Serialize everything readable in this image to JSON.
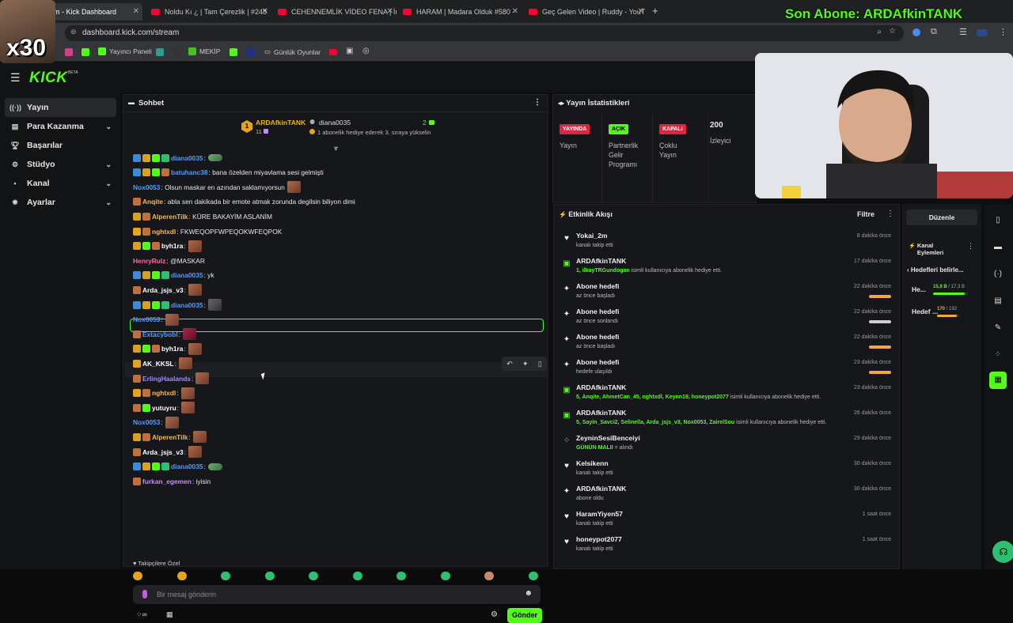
{
  "browser": {
    "tabs": [
      {
        "label": "m - Kick Dashboard",
        "active": true
      },
      {
        "label": "Noldu Kı ¿ | Tam Çerezlik | #248"
      },
      {
        "label": "CEHENNEMLİK VİDEO FENA | İn"
      },
      {
        "label": "HARAM | Madara Olduk #580 -"
      },
      {
        "label": "Geç Gelen Video | Ruddy - YouT"
      }
    ],
    "url": "dashboard.kick.com/stream",
    "bookmarks": [
      "Yayıncı Paneli",
      "MEKİP",
      "Günlük Oyunlar"
    ]
  },
  "overlay": {
    "latest_sub": "Son Abone: ARDAfkinTANK",
    "multiplier": "x30"
  },
  "brand": {
    "logo": "KICK",
    "beta": "BETA",
    "accent": "#53fc18"
  },
  "sidebar": {
    "items": [
      {
        "label": "Yayın",
        "icon": "broadcast-icon",
        "active": true
      },
      {
        "label": "Para Kazanma",
        "icon": "money-icon",
        "chevron": true
      },
      {
        "label": "Başarılar",
        "icon": "trophy-icon"
      },
      {
        "label": "Stüdyo",
        "icon": "studio-icon",
        "chevron": true
      },
      {
        "label": "Kanal",
        "icon": "channel-icon",
        "chevron": true
      },
      {
        "label": "Ayarlar",
        "icon": "settings-icon",
        "chevron": true
      }
    ]
  },
  "chat": {
    "title": "Sohbet",
    "pinned": {
      "rank": "1",
      "user": "ARDAfkinTANK",
      "count": "11",
      "gifter": "diana0035",
      "gift_count": "2",
      "notice": "1 abonelik hediye ederek 3. sıraya yükselin"
    },
    "messages": [
      {
        "user": "diana0035",
        "text": ":",
        "color": "#4f9dff",
        "badges": [
          "#3a8bd8",
          "#d6a21f",
          "#53fc18",
          "#2fbf71"
        ],
        "emote": "g"
      },
      {
        "user": "batuhanc38",
        "text": ": bana özelden miyavlama sesi gelmişti",
        "color": "#4f9dff",
        "badges": [
          "#3a8bd8",
          "#d6a21f",
          "#53fc18",
          "#c0703a"
        ]
      },
      {
        "user": "Nox0053",
        "text": ": Olsun maskar en azından saklamıyorsun",
        "color": "#4f9dff",
        "badges": [],
        "emote": "f"
      },
      {
        "user": "Anqite",
        "text": ": abla sen dakikada bir emote atmak zorunda degilsin biliyon dimi",
        "color": "#ffb74d",
        "badges": [
          "#c0703a"
        ]
      },
      {
        "user": "AlperenTilk",
        "text": ": KÜRE BAKAYİM ASLANİM",
        "color": "#ffb74d",
        "badges": [
          "#d6a21f",
          "#c0703a"
        ]
      },
      {
        "user": "nghtxdl",
        "text": ": FKWEQOPFWPEQOKWFEQPOK",
        "color": "#ffb74d",
        "badges": [
          "#e5a419",
          "#c0703a"
        ]
      },
      {
        "user": "byh1ra",
        "text": ":",
        "color": "#ffffff",
        "badges": [
          "#d6a21f",
          "#53fc18",
          "#c0703a"
        ],
        "emote": "f"
      },
      {
        "user": "HenryRulz",
        "text": ": @MASKAR",
        "color": "#ff6b9a",
        "badges": []
      },
      {
        "user": "diana0035",
        "text": ": yk",
        "color": "#4f9dff",
        "badges": [
          "#3a8bd8",
          "#d6a21f",
          "#53fc18",
          "#2fbf71"
        ]
      },
      {
        "user": "Arda_jsjs_v3",
        "text": ":",
        "color": "#ffffff",
        "badges": [
          "#c0703a"
        ],
        "emote": "f"
      },
      {
        "user": "diana0035",
        "text": ":",
        "color": "#4f9dff",
        "badges": [
          "#3a8bd8",
          "#d6a21f",
          "#53fc18",
          "#2fbf71"
        ],
        "emote": "d"
      },
      {
        "user": "Nox0053",
        "text": ":",
        "color": "#4f9dff",
        "badges": [],
        "emote": "f"
      },
      {
        "user": "Extacybobl",
        "text": ":",
        "color": "#4f9dff",
        "badges": [
          "#c0703a"
        ],
        "emote": "r"
      },
      {
        "user": "byh1ra",
        "text": ":",
        "color": "#ffffff",
        "badges": [
          "#d6a21f",
          "#53fc18",
          "#c0703a"
        ],
        "emote": "f"
      },
      {
        "user": "AK_KKSL",
        "text": ":",
        "color": "#ffffff",
        "badges": [
          "#e5a419"
        ],
        "emote": "f"
      },
      {
        "user": "ErlingHaalands",
        "text": ":",
        "color": "#a98bff",
        "badges": [
          "#c0703a"
        ],
        "emote": "f"
      },
      {
        "user": "nghtxdl",
        "text": ":",
        "color": "#ffb74d",
        "badges": [
          "#e5a419",
          "#c0703a"
        ],
        "emote": "f"
      },
      {
        "user": "yutuyru",
        "text": ":",
        "color": "#ffffff",
        "badges": [
          "#c0703a",
          "#53fc18"
        ],
        "emote": "f"
      },
      {
        "user": "Nox0053",
        "text": ":",
        "color": "#4f9dff",
        "badges": [],
        "emote": "f"
      },
      {
        "user": "AlperenTilk",
        "text": ":",
        "color": "#ffb74d",
        "badges": [
          "#d6a21f",
          "#c0703a"
        ],
        "emote": "f"
      },
      {
        "user": "Arda_jsjs_v3",
        "text": ":",
        "color": "#ffffff",
        "badges": [
          "#c0703a"
        ],
        "emote": "f"
      },
      {
        "user": "diana0035",
        "text": ":",
        "color": "#4f9dff",
        "badges": [
          "#3a8bd8",
          "#d6a21f",
          "#53fc18",
          "#2fbf71"
        ],
        "emote": "g"
      },
      {
        "user": "furkan_egemen",
        "text": ": iyisin",
        "color": "#c58bff",
        "badges": [
          "#c0703a"
        ]
      }
    ],
    "followers_only": "Takipçilere Özel",
    "input_placeholder": "Bir mesaj gönderin",
    "send_label": "Gönder"
  },
  "stats": {
    "title": "Yayın İstatistikleri",
    "cols": [
      {
        "pill": "YAYINDA",
        "pill_bg": "#e0263f",
        "pill_fg": "#ffffff",
        "label": "Yayın"
      },
      {
        "pill": "AÇIK",
        "pill_bg": "#53fc18",
        "pill_fg": "#000000",
        "label": "Partnerlik Gelir Programı"
      },
      {
        "pill": "KAPALI",
        "pill_bg": "#e0263f",
        "pill_fg": "#ffffff",
        "label": "Çoklu Yayın"
      },
      {
        "pill": "200",
        "pill_bg": "transparent",
        "pill_fg": "#ffffff",
        "label": "İzleyici"
      }
    ]
  },
  "activity": {
    "title": "Etkinlik Akışı",
    "filter": "Filtre",
    "items": [
      {
        "icon": "heart-icon",
        "name": "Yokai_2m",
        "sub": "kanalı takip etti",
        "time": "8 dakika önce"
      },
      {
        "icon": "gift-icon",
        "name": "ARDAfkinTANK",
        "hl": "1, ilkayTRGundogan",
        "sub": " isimli kullanıcıya abonelik hediye etti.",
        "time": "17 dakika önce"
      },
      {
        "icon": "sparkle-icon",
        "name": "Abone hedefi",
        "sub": "az önce başladı",
        "time": "22 dakika önce",
        "bar": "#f4a640"
      },
      {
        "icon": "sparkle-icon",
        "name": "Abone hedefi",
        "sub": "az önce sonlandı",
        "time": "22 dakika önce",
        "bar": "#cfcfcf"
      },
      {
        "icon": "sparkle-icon",
        "name": "Abone hedefi",
        "sub": "az önce başladı",
        "time": "22 dakika önce",
        "bar": "#f4a640"
      },
      {
        "icon": "sparkle-icon",
        "name": "Abone hedefi",
        "sub": "hedefe ulaşıldı",
        "time": "23 dakika önce",
        "bar": "#f4a640"
      },
      {
        "icon": "gift-icon",
        "name": "ARDAfkinTANK",
        "hl": "5, Anqite, AhmetCan_45, nghtxdl, Keynn18, honeypot2077",
        "sub": " isimli kullanıcıya abonelik hediye etti.",
        "time": "23 dakika önce"
      },
      {
        "icon": "gift-icon",
        "name": "ARDAfkinTANK",
        "hl": "5, Sayin_Savci2, Selinella, Arda_jsjs_v3, Nox0053, ZairelSou",
        "sub": " isimli kullanıcıya abonelik hediye etti.",
        "time": "26 dakika önce"
      },
      {
        "icon": "kicks-icon",
        "name": "ZeyninSesiBenceiyi",
        "hl": "GÜNÜN MALII",
        "sub": " = alındı",
        "time": "29 dakika önce"
      },
      {
        "icon": "heart-icon",
        "name": "Kelsikenn",
        "sub": "kanalı takip etti",
        "time": "30 dakika önce"
      },
      {
        "icon": "sparkle-icon",
        "name": "ARDAfkinTANK",
        "sub": "abone oldu",
        "time": "30 dakika önce"
      },
      {
        "icon": "heart-icon",
        "name": "HaramYiyen57",
        "sub": "kanalı takip etti",
        "time": "1 saat önce"
      },
      {
        "icon": "heart-icon",
        "name": "honeypot2077",
        "sub": "kanalı takip etti",
        "time": "1 saat önce"
      }
    ]
  },
  "right_panel": {
    "edit": "Düzenle",
    "title": "Kanal Eylemleri",
    "goals_title": "Hedefleri belirle...",
    "goals": [
      {
        "name": "He...",
        "value": "15,9 B",
        "total": "/ 17,3 B",
        "progress": 0.92,
        "color": "#53fc18"
      },
      {
        "name": "Hedef ...",
        "value": "170",
        "total": "/ 192",
        "progress": 0.88,
        "color": "#f4a640"
      }
    ]
  }
}
